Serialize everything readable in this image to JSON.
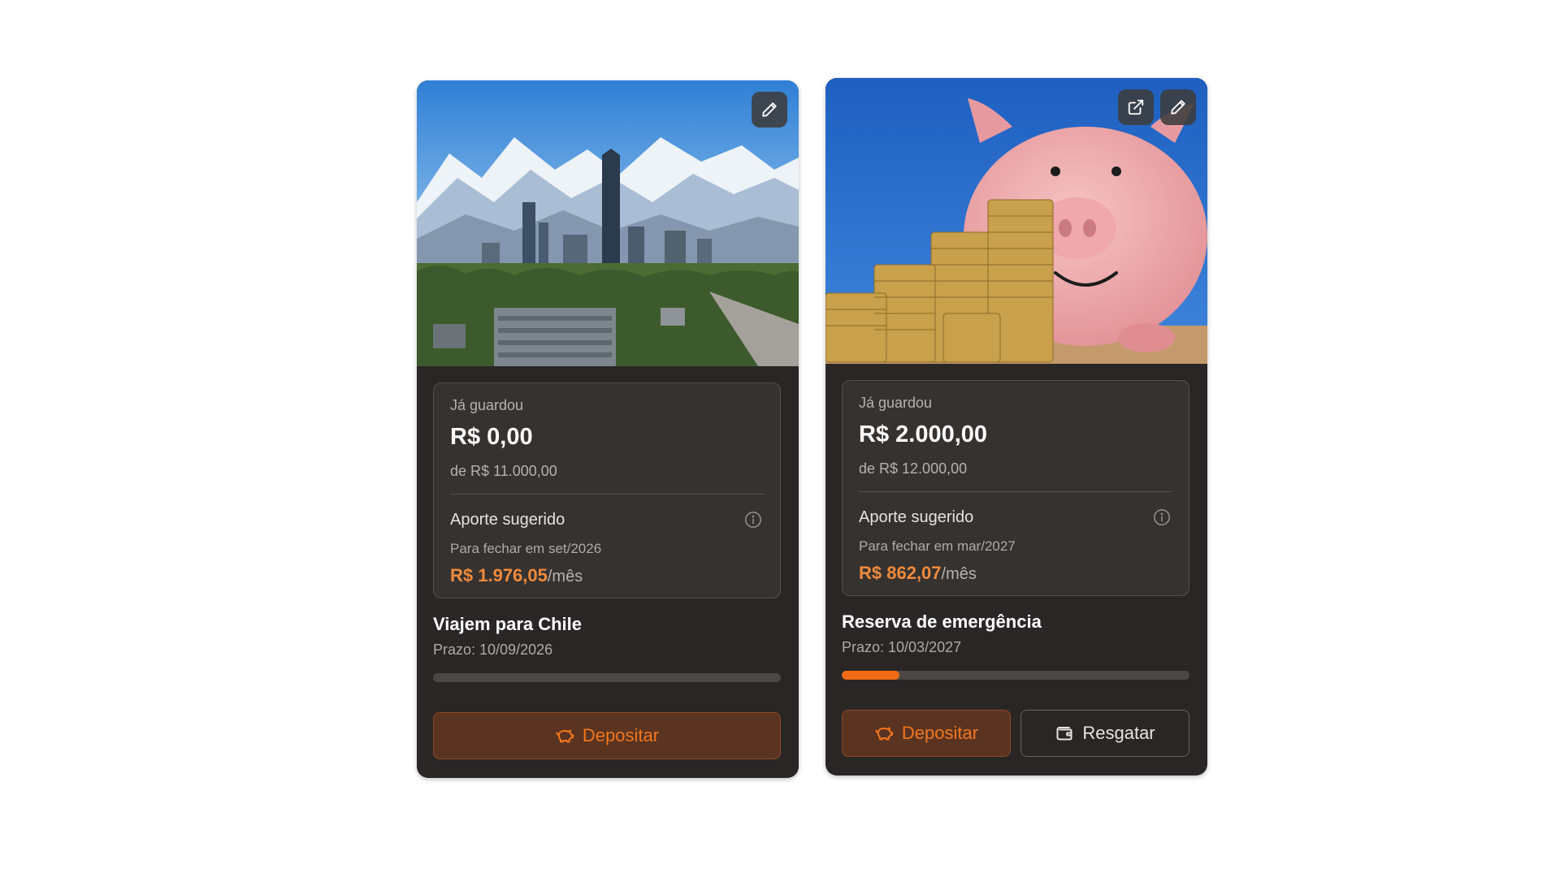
{
  "goals": [
    {
      "saved_label": "Já guardou",
      "saved_amount": "R$ 0,00",
      "target": "de R$ 11.000,00",
      "aporte_label": "Aporte sugerido",
      "close_label": "Para fechar em set/2026",
      "aporte_value": "R$ 1.976,05",
      "aporte_unit": "/mês",
      "title": "Viajem para Chile",
      "deadline": "Prazo: 10/09/2026",
      "progress": 0.0,
      "deposit_label": "Depositar",
      "image": "santiago-skyline-photo",
      "actions": [
        "edit-icon"
      ]
    },
    {
      "saved_label": "Já guardou",
      "saved_amount": "R$ 2.000,00",
      "target": "de R$ 12.000,00",
      "aporte_label": "Aporte sugerido",
      "close_label": "Para fechar em mar/2027",
      "aporte_value": "R$ 862,07",
      "aporte_unit": "/mês",
      "title": "Reserva de emergência",
      "deadline": "Prazo: 10/03/2027",
      "progress": 0.1667,
      "deposit_label": "Depositar",
      "redeem_label": "Resgatar",
      "image": "piggy-bank-coins-photo",
      "actions": [
        "external-link-icon",
        "edit-icon"
      ]
    }
  ],
  "colors": {
    "card_bg": "#2a2625",
    "accent": "#f26a12",
    "aporte_value": "#f08a3c"
  }
}
